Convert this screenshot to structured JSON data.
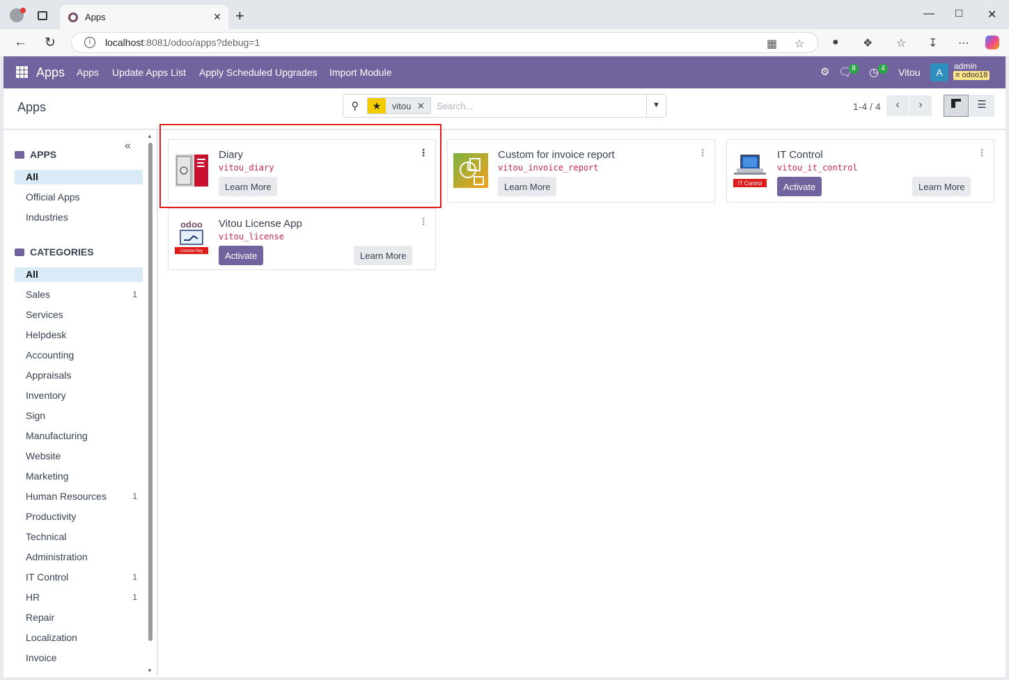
{
  "browser": {
    "tab_title": "Apps",
    "tab_close": "✕",
    "new_tab": "+",
    "url_host": "localhost",
    "url_rest": ":8081/odoo/apps?debug=1"
  },
  "navbar": {
    "brand": "Apps",
    "menu": [
      "Apps",
      "Update Apps List",
      "Apply Scheduled Upgrades",
      "Import Module"
    ],
    "messages_badge": "8",
    "activities_badge": "4",
    "company": "Vitou",
    "avatar_letter": "A",
    "user": "admin",
    "database": "odoo18"
  },
  "control_panel": {
    "breadcrumb": "Apps",
    "facet_value": "vitou",
    "search_placeholder": "Search...",
    "pager": "1-4 / 4"
  },
  "sidebar": {
    "apps_heading": "APPS",
    "apps_items": [
      {
        "label": "All",
        "active": true
      },
      {
        "label": "Official Apps"
      },
      {
        "label": "Industries"
      }
    ],
    "categories_heading": "CATEGORIES",
    "categories": [
      {
        "label": "All",
        "count": ""
      },
      {
        "label": "Sales",
        "count": "1"
      },
      {
        "label": "Services",
        "count": ""
      },
      {
        "label": "Helpdesk",
        "count": ""
      },
      {
        "label": "Accounting",
        "count": ""
      },
      {
        "label": "Appraisals",
        "count": ""
      },
      {
        "label": "Inventory",
        "count": ""
      },
      {
        "label": "Sign",
        "count": ""
      },
      {
        "label": "Manufacturing",
        "count": ""
      },
      {
        "label": "Website",
        "count": ""
      },
      {
        "label": "Marketing",
        "count": ""
      },
      {
        "label": "Human Resources",
        "count": "1"
      },
      {
        "label": "Productivity",
        "count": ""
      },
      {
        "label": "Technical",
        "count": ""
      },
      {
        "label": "Administration",
        "count": ""
      },
      {
        "label": "IT Control",
        "count": "1"
      },
      {
        "label": "HR",
        "count": "1"
      },
      {
        "label": "Repair",
        "count": ""
      },
      {
        "label": "Localization",
        "count": ""
      },
      {
        "label": "Invoice",
        "count": ""
      }
    ]
  },
  "cards": [
    {
      "name": "Diary",
      "technical": "vitou_diary",
      "learn_more": "Learn More"
    },
    {
      "name": "Custom for invoice report",
      "technical": "vitou_invoice_report",
      "learn_more": "Learn More"
    },
    {
      "name": "IT Control",
      "technical": "vitou_it_control",
      "activate": "Activate",
      "learn_more": "Learn More",
      "icon_label": "IT Control"
    },
    {
      "name": "Vitou License App",
      "technical": "vitou_license",
      "activate": "Activate",
      "learn_more": "Learn More",
      "icon_label": "License Key",
      "icon_logo": "odoo"
    }
  ],
  "colors": {
    "odoo_purple": "#71639e",
    "highlight_red": "#e01b1b",
    "tech_name_red": "#c7254e"
  }
}
